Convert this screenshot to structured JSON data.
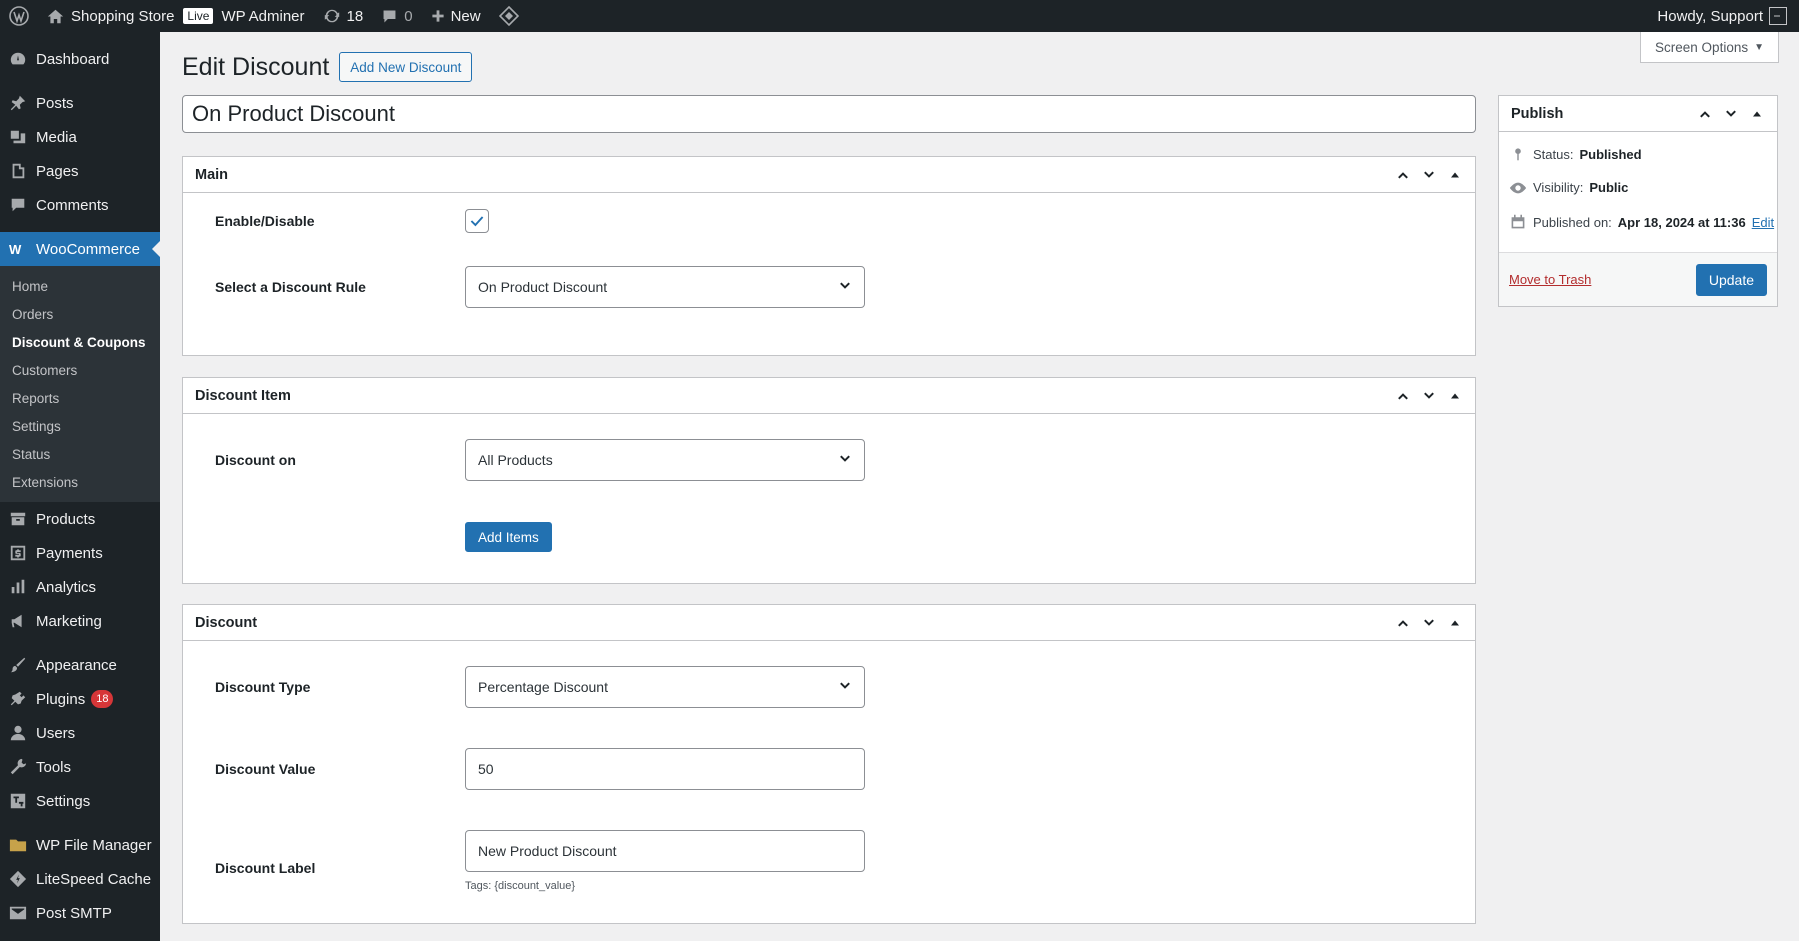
{
  "adminbar": {
    "site_name": "Shopping Store",
    "live_badge": "Live",
    "wp_adminer": "WP Adminer",
    "updates_count": "18",
    "comments_count": "0",
    "new_label": "New",
    "howdy": "Howdy, Support"
  },
  "sidebar": {
    "dashboard": "Dashboard",
    "posts": "Posts",
    "media": "Media",
    "pages": "Pages",
    "comments": "Comments",
    "woocommerce": "WooCommerce",
    "sub": {
      "home": "Home",
      "orders": "Orders",
      "discounts": "Discount & Coupons",
      "customers": "Customers",
      "reports": "Reports",
      "settings": "Settings",
      "status": "Status",
      "extensions": "Extensions"
    },
    "products": "Products",
    "payments": "Payments",
    "analytics": "Analytics",
    "marketing": "Marketing",
    "appearance": "Appearance",
    "plugins": "Plugins",
    "plugins_count": "18",
    "users": "Users",
    "tools": "Tools",
    "settings": "Settings",
    "file_manager": "WP File Manager",
    "litespeed": "LiteSpeed Cache",
    "post_smtp": "Post SMTP"
  },
  "header": {
    "screen_options": "Screen Options",
    "title": "Edit Discount",
    "add_new": "Add New Discount"
  },
  "post_title": "On Product Discount",
  "main_box": {
    "title": "Main",
    "enable_label": "Enable/Disable",
    "enabled": true,
    "rule_label": "Select a Discount Rule",
    "rule_value": "On Product Discount"
  },
  "item_box": {
    "title": "Discount Item",
    "on_label": "Discount on",
    "on_value": "All Products",
    "add_items": "Add Items"
  },
  "discount_box": {
    "title": "Discount",
    "type_label": "Discount Type",
    "type_value": "Percentage Discount",
    "value_label": "Discount Value",
    "value": "50",
    "label_label": "Discount Label",
    "label_value": "New Product Discount",
    "tags_hint": "Tags: {discount_value}"
  },
  "publish": {
    "title": "Publish",
    "status_label": "Status:",
    "status_value": "Published",
    "visibility_label": "Visibility:",
    "visibility_value": "Public",
    "published_label": "Published on:",
    "published_value": "Apr 18, 2024 at 11:36",
    "edit": "Edit",
    "trash": "Move to Trash",
    "update": "Update"
  },
  "colors": {
    "accent": "#2271b1",
    "adminbar": "#1d2327",
    "badge": "#d63638"
  }
}
